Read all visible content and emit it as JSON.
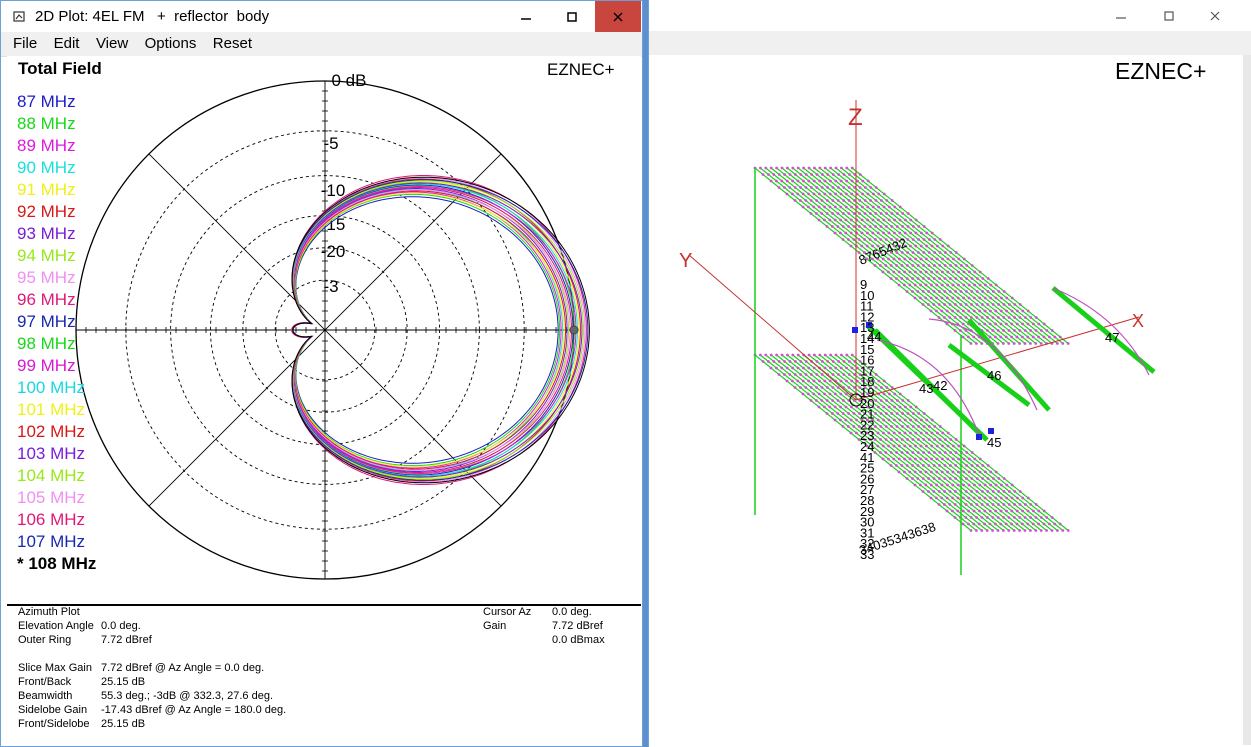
{
  "left_window": {
    "title": "2D Plot: 4EL FM   +  reflector  body",
    "menu": [
      "File",
      "Edit",
      "View",
      "Options",
      "Reset"
    ],
    "plot_title": "Total Field",
    "brand": "EZNEC+",
    "ring_labels": [
      "0 dB",
      "-5",
      "-10",
      "-15",
      "-20",
      "-3"
    ],
    "legend": [
      {
        "label": "87 MHz",
        "color": "#1c1cc8"
      },
      {
        "label": "88 MHz",
        "color": "#18d818"
      },
      {
        "label": "89 MHz",
        "color": "#e018e0"
      },
      {
        "label": "90 MHz",
        "color": "#18e0e0"
      },
      {
        "label": "91 MHz",
        "color": "#f0f018"
      },
      {
        "label": "92 MHz",
        "color": "#d81818"
      },
      {
        "label": "93 MHz",
        "color": "#7a1cd8"
      },
      {
        "label": "94 MHz",
        "color": "#98e818"
      },
      {
        "label": "95 MHz",
        "color": "#f090f0"
      },
      {
        "label": "96 MHz",
        "color": "#e01878"
      },
      {
        "label": "97 MHz",
        "color": "#1828b0"
      },
      {
        "label": "98 MHz",
        "color": "#18d818"
      },
      {
        "label": "99 MHz",
        "color": "#d818d8"
      },
      {
        "label": "100 MHz",
        "color": "#18d8e0"
      },
      {
        "label": "101 MHz",
        "color": "#f0f018"
      },
      {
        "label": "102 MHz",
        "color": "#d81818"
      },
      {
        "label": "103 MHz",
        "color": "#7a1cd8"
      },
      {
        "label": "104 MHz",
        "color": "#98e818"
      },
      {
        "label": "105 MHz",
        "color": "#f090f0"
      },
      {
        "label": "106 MHz",
        "color": "#e01878"
      },
      {
        "label": "107 MHz",
        "color": "#1828b0"
      },
      {
        "label": "* 108 MHz",
        "color": "#000000"
      }
    ],
    "info": {
      "plot_type": "Azimuth Plot",
      "elev_label": "Elevation Angle",
      "elev_value": "0.0 deg.",
      "outer_label": "Outer Ring",
      "outer_value": "7.72 dBref",
      "cursor_label": "Cursor Az",
      "cursor_value": "0.0 deg.",
      "gain_label": "Gain",
      "gain_value": "7.72 dBref",
      "gain_value2": "0.0 dBmax",
      "slice_label": "Slice Max Gain",
      "slice_value": "7.72 dBref @ Az Angle = 0.0 deg.",
      "fb_label": "Front/Back",
      "fb_value": "25.15 dB",
      "bw_label": "Beamwidth",
      "bw_value": "55.3 deg.; -3dB @ 332.3, 27.6 deg.",
      "sl_label": "Sidelobe Gain",
      "sl_value": "-17.43 dBref @ Az Angle = 180.0 deg.",
      "fs_label": "Front/Sidelobe",
      "fs_value": "25.15 dB"
    }
  },
  "right_window": {
    "brand": "EZNEC+",
    "axis_labels": {
      "z": "Z",
      "y": "Y",
      "x": "X"
    },
    "wire_labels_top": "8765432",
    "wire_numbers_left": [
      "9",
      "10",
      "11",
      "12",
      "13",
      "14",
      "15",
      "16",
      "17",
      "18",
      "19",
      "20",
      "21",
      "22",
      "23",
      "24",
      "41",
      "25",
      "26",
      "27",
      "28",
      "29",
      "30",
      "31",
      "32",
      "33"
    ],
    "wire_labels_bottom": "34035343638",
    "element_labels": [
      "44",
      "43",
      "42",
      "46",
      "45",
      "47"
    ]
  }
}
